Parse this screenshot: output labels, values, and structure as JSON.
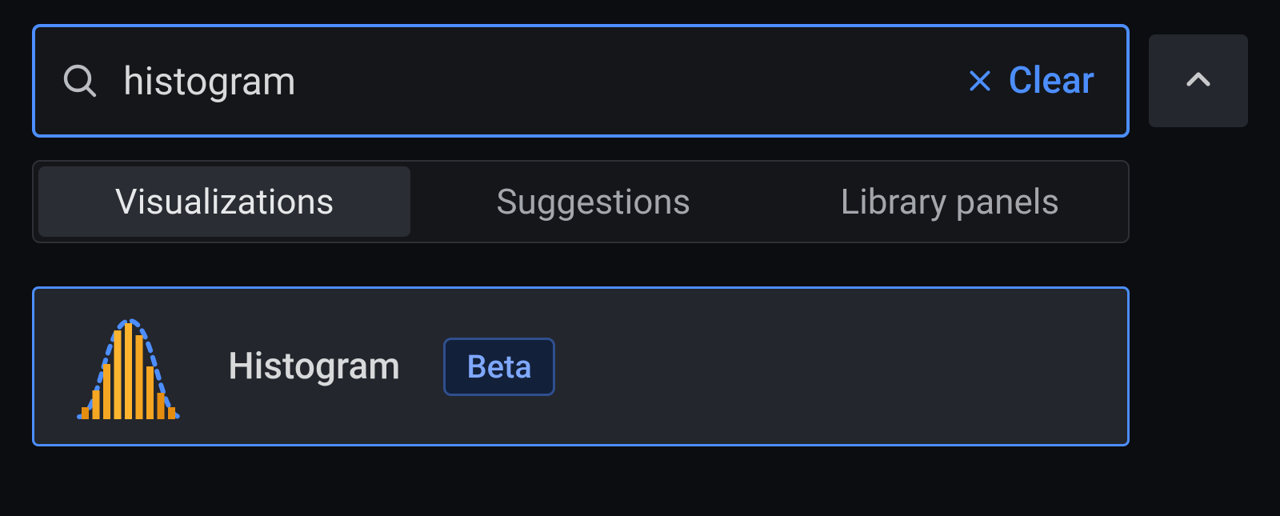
{
  "search": {
    "value": "histogram",
    "clear_label": "Clear"
  },
  "tabs": [
    {
      "id": "visualizations",
      "label": "Visualizations",
      "active": true
    },
    {
      "id": "suggestions",
      "label": "Suggestions",
      "active": false
    },
    {
      "id": "library",
      "label": "Library panels",
      "active": false
    }
  ],
  "results": [
    {
      "id": "histogram",
      "title": "Histogram",
      "badge": "Beta",
      "icon": "histogram-icon"
    }
  ],
  "colors": {
    "accent": "#4d8eff",
    "orange": "#f5a623"
  }
}
